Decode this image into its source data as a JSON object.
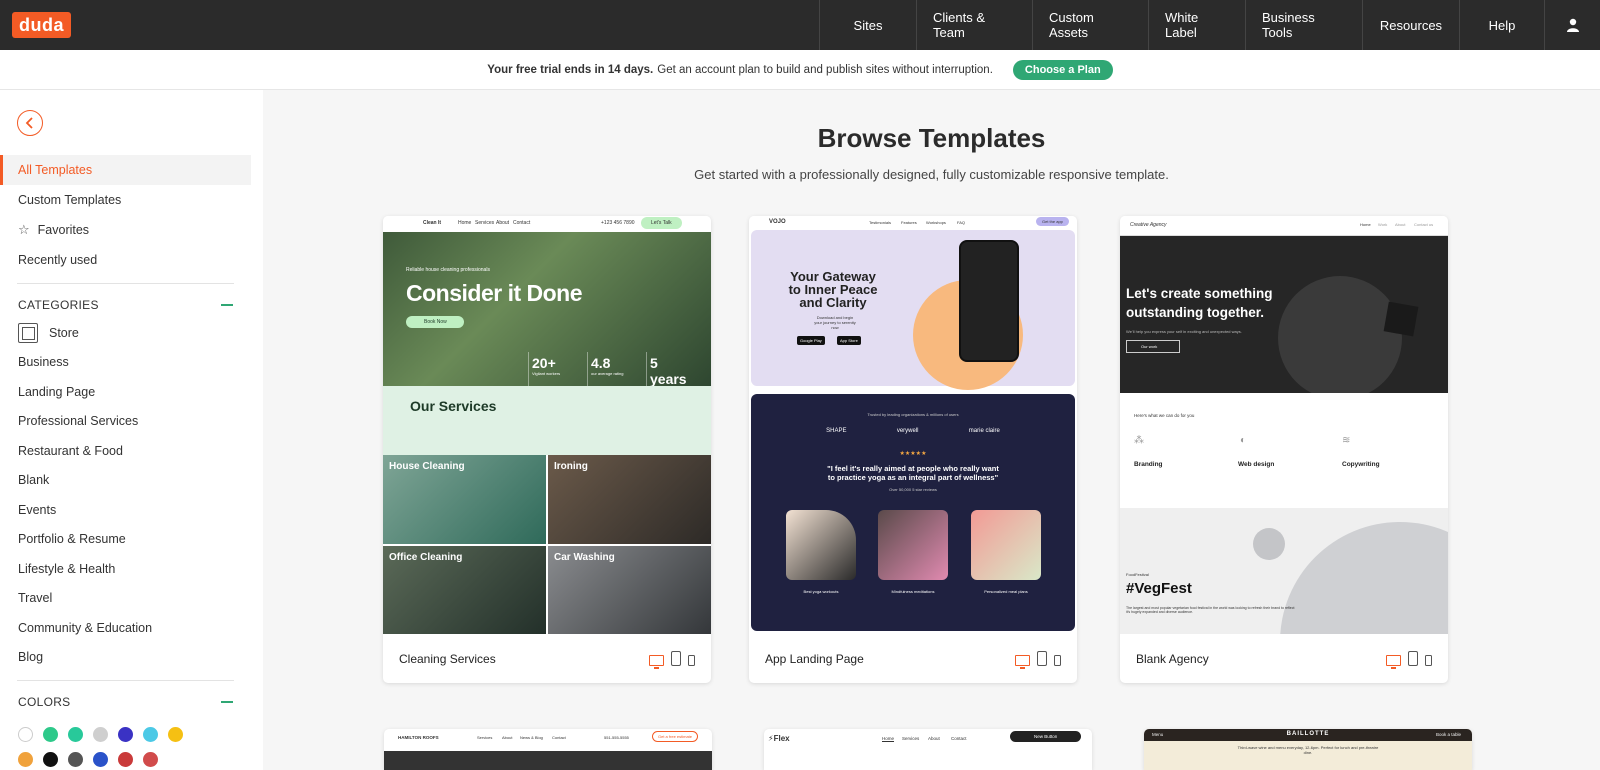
{
  "brand": {
    "logo": "duda",
    "accent": "#f35b25",
    "green": "#2fa774"
  },
  "nav": {
    "items": [
      "Sites",
      "Clients & Team",
      "Custom Assets",
      "White Label",
      "Business Tools",
      "Resources",
      "Help"
    ],
    "user_icon": "user-icon"
  },
  "banner": {
    "bold": "Your free trial ends in 14 days.",
    "message": "Get an account plan to build and publish sites without interruption.",
    "cta": "Choose a Plan"
  },
  "sidebar": {
    "back_icon": "chevron-left-icon",
    "menu": [
      {
        "label": "All Templates",
        "active": true
      },
      {
        "label": "Custom Templates"
      },
      {
        "label": "Favorites",
        "icon": "star-icon"
      },
      {
        "label": "Recently used"
      }
    ],
    "categories_title": "CATEGORIES",
    "categories": [
      "Store",
      "Business",
      "Landing Page",
      "Professional Services",
      "Restaurant & Food",
      "Blank",
      "Events",
      "Portfolio & Resume",
      "Lifestyle & Health",
      "Travel",
      "Community & Education",
      "Blog"
    ],
    "colors_title": "COLORS",
    "colors": [
      "#ffffff",
      "#2ec98a",
      "#28c99a",
      "#cfcfcf",
      "#3a32c4",
      "#4cc9e6",
      "#f5c013"
    ],
    "colors_row2": [
      "#f0a23c",
      "#111111",
      "#555555",
      "#2a52c9",
      "#c93a3a",
      "#d14b4b"
    ]
  },
  "main": {
    "title": "Browse Templates",
    "subtitle": "Get started with a professionally designed, fully customizable responsive template."
  },
  "templates": [
    {
      "name": "Cleaning Services",
      "preview": {
        "brand": "Clean It",
        "cta": "Let's Talk",
        "phone": "+123 456 7890",
        "nav": [
          "Home",
          "Services",
          "About",
          "Contact"
        ],
        "tagline": "Reliable house cleaning professionals",
        "title": "Consider it Done",
        "book": "Book Now",
        "stats": [
          "20+",
          "4.8",
          "5 years"
        ],
        "stat_labels": [
          "Vigilant workers",
          "our average rating",
          "on the market"
        ],
        "services_title": "Our Services",
        "tiles": [
          "House Cleaning",
          "Ironing",
          "Office Cleaning",
          "Car Washing"
        ]
      }
    },
    {
      "name": "App Landing Page",
      "preview": {
        "brand": "VOJO",
        "nav": [
          "Testimonials",
          "Features",
          "Workshops",
          "FAQ"
        ],
        "cta": "Get the app",
        "hero": "Your Gateway to Inner Peace and Clarity",
        "hero_sub": "Download and begin your journey to serenity now",
        "stores": [
          "Google Play",
          "App Store"
        ],
        "trusted": "Trusted by leading organizations & millions of users",
        "logos": [
          "SHAPE",
          "verywell",
          "marie claire"
        ],
        "stars": "★★★★★",
        "quote": "\"I feel it's really aimed at people who really want to practice yoga as an integral part of wellness\"",
        "reviews": "Over 50,000 5 star reviews",
        "features": [
          "Best yoga workouts",
          "Mindfulness meditations",
          "Personalized meal plans"
        ]
      }
    },
    {
      "name": "Blank Agency",
      "preview": {
        "brand": "Creative Agency",
        "nav": [
          "Home",
          "Work",
          "About",
          "Contact us"
        ],
        "hero": "Let's create something outstanding together.",
        "hero_sub": "We'll help you express your self in exciting and unexpected ways.",
        "hero_btn": "Our work",
        "intro": "Here's what we can do for you",
        "features": [
          "Branding",
          "Web design",
          "Copywriting"
        ],
        "fest_kicker": "FoodFestival",
        "fest_title": "#VegFest",
        "fest_text": "The largest and most popular vegetarian food festival in the world was looking to refresh their brand to reflect it's hugely expanded and diverse audience."
      }
    }
  ],
  "next_row": [
    {
      "brand": "HAMILTON ROOFS",
      "nav": [
        "Services",
        "About",
        "News & Blog",
        "Contact"
      ],
      "phone": "551-555-5555",
      "cta": "Get a free estimate"
    },
    {
      "brand": "Flex",
      "nav": [
        "Home",
        "Services",
        "About",
        "Contact"
      ],
      "cta": "New Button"
    },
    {
      "brand": "BAILLOTTE",
      "left": "Menu",
      "right": "Book a table",
      "tagline": "Third-wave wine and menu everyday, 12-6pm. Perfect for lunch and pre-theatre dine."
    }
  ],
  "device_icons": [
    "desktop-icon",
    "tablet-icon",
    "phone-icon"
  ]
}
